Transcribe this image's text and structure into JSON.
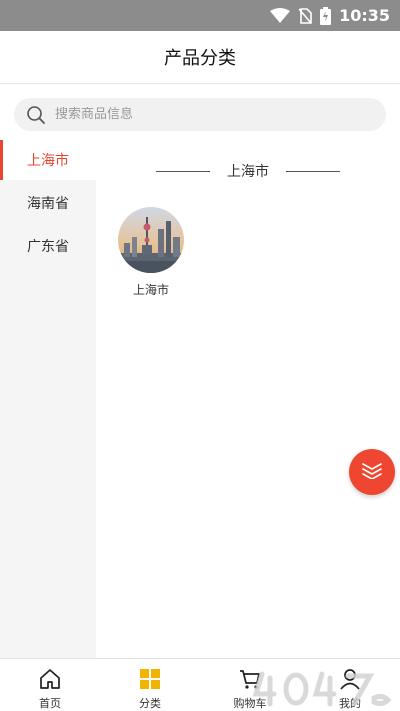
{
  "status_bar": {
    "time": "10:35",
    "icons": [
      "wifi-icon",
      "no-sim-icon",
      "battery-charging-icon"
    ]
  },
  "header": {
    "title": "产品分类"
  },
  "search": {
    "placeholder": "搜索商品信息",
    "value": ""
  },
  "sidebar": {
    "items": [
      {
        "label": "上海市",
        "active": true
      },
      {
        "label": "海南省",
        "active": false
      },
      {
        "label": "广东省",
        "active": false
      }
    ]
  },
  "content": {
    "section_title": "上海市",
    "items": [
      {
        "label": "上海市",
        "icon": "city-skyline-thumbnail"
      }
    ]
  },
  "fab": {
    "icon": "layers-icon"
  },
  "bottom_nav": {
    "items": [
      {
        "label": "首页",
        "icon": "home-icon"
      },
      {
        "label": "分类",
        "icon": "category-grid-icon",
        "active": true
      },
      {
        "label": "购物车",
        "icon": "cart-icon"
      },
      {
        "label": "我的",
        "icon": "user-icon"
      }
    ]
  },
  "colors": {
    "accent": "#e8452e",
    "category_active": "#f2b400",
    "status_bar": "#8c8c8c",
    "sidebar_bg": "#f5f5f5"
  }
}
